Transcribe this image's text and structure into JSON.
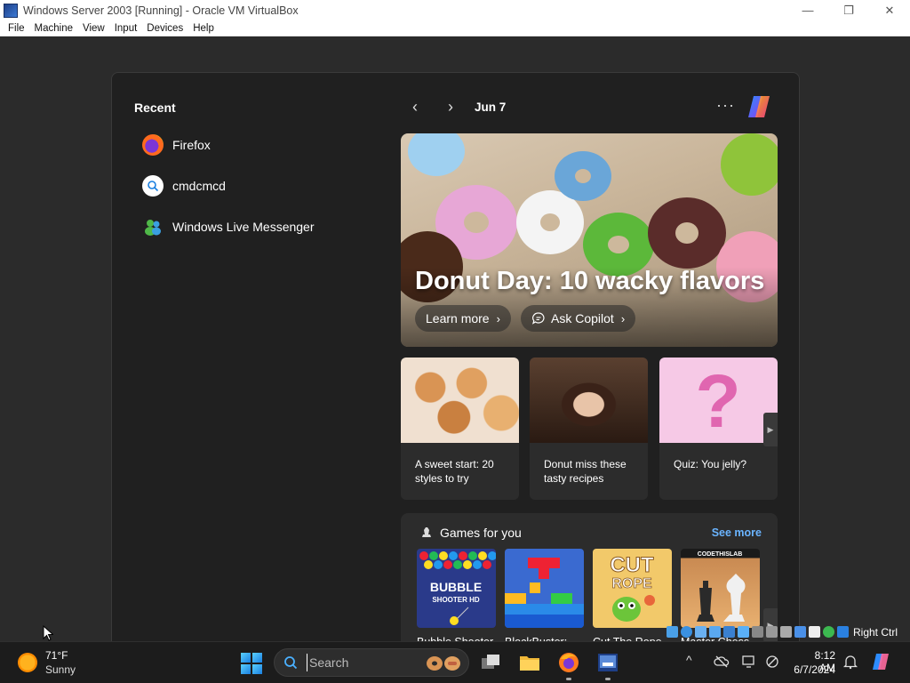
{
  "window": {
    "title": "Windows Server 2003 [Running] - Oracle VM VirtualBox",
    "minimize_glyph": "—",
    "restore_glyph": "❐",
    "close_glyph": "✕"
  },
  "menubar": {
    "items": [
      "File",
      "Machine",
      "View",
      "Input",
      "Devices",
      "Help"
    ]
  },
  "widgets": {
    "recent_title": "Recent",
    "recent_items": [
      {
        "label": "Firefox",
        "icon": "firefox-icon"
      },
      {
        "label": "cmdcmcd",
        "icon": "search-icon"
      },
      {
        "label": "Windows Live Messenger",
        "icon": "messenger-icon"
      }
    ],
    "prev_glyph": "‹",
    "next_glyph": "›",
    "date": "Jun 7",
    "more_glyph": "···",
    "hero": {
      "title": "Donut Day: 10 wacky flavors",
      "learn_more": "Learn more",
      "ask_copilot": "Ask Copilot",
      "chevron": "›"
    },
    "cards": [
      {
        "text": "A sweet start: 20 styles to try"
      },
      {
        "text": "Donut miss these tasty recipes"
      },
      {
        "text": "Quiz: You jelly?"
      }
    ],
    "scroll_glyph": "▶",
    "games": {
      "title": "Games for you",
      "see_more": "See more",
      "items": [
        {
          "label": "Bubble Shooter HD",
          "thumb_text": "BUBBLE SHOOTER HD"
        },
        {
          "label": "BlockBuster: Adventures ..."
        },
        {
          "label": "Cut The Rope",
          "thumb_text": "CUT the ROPE"
        },
        {
          "label": "Master Chess",
          "thumb_text": "CODETHISLAB"
        }
      ]
    }
  },
  "vbox_status": {
    "host_key": "Right Ctrl"
  },
  "taskbar": {
    "weather_temp": "71°F",
    "weather_cond": "Sunny",
    "search_placeholder": "Search",
    "chevron_up": "^",
    "time": "8:12 AM",
    "date": "6/7/2024"
  },
  "colors": {
    "accent_link": "#6ab4ff",
    "panel_bg": "#202020",
    "card_bg": "#2c2c2c",
    "taskbar_bg": "#1c1c1c"
  }
}
